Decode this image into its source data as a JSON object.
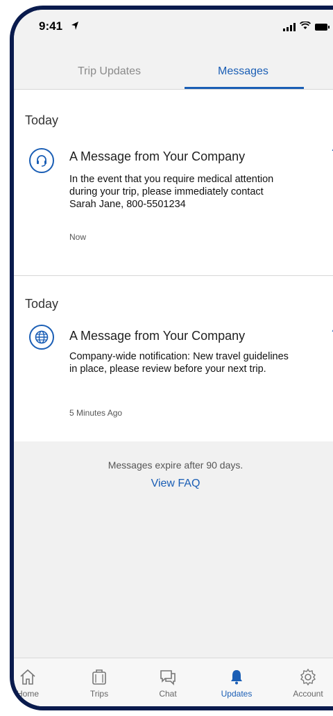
{
  "status_bar": {
    "time": "9:41"
  },
  "tabs": [
    {
      "label": "Trip Updates",
      "active": false
    },
    {
      "label": "Messages",
      "active": true
    }
  ],
  "messages": [
    {
      "section": "Today",
      "icon": "headset-icon",
      "title": "A Message from Your Company",
      "body": "In the event that you require medical attention during your trip, please immediately contact Sarah Jane, 800-5501234",
      "time": "Now"
    },
    {
      "section": "Today",
      "icon": "globe-icon",
      "title": "A Message from Your Company",
      "body": "Company-wide notification: New travel guidelines in place, please review before your next trip.",
      "time": "5 Minutes Ago"
    }
  ],
  "footer": {
    "note": "Messages expire after 90 days.",
    "link": "View FAQ"
  },
  "nav": [
    {
      "label": "Home",
      "icon": "home-icon"
    },
    {
      "label": "Trips",
      "icon": "luggage-icon"
    },
    {
      "label": "Chat",
      "icon": "chat-icon"
    },
    {
      "label": "Updates",
      "icon": "bell-icon",
      "active": true
    },
    {
      "label": "Account",
      "icon": "gear-icon"
    }
  ],
  "colors": {
    "accent": "#1a5eb5",
    "frame": "#0a1b4d"
  }
}
